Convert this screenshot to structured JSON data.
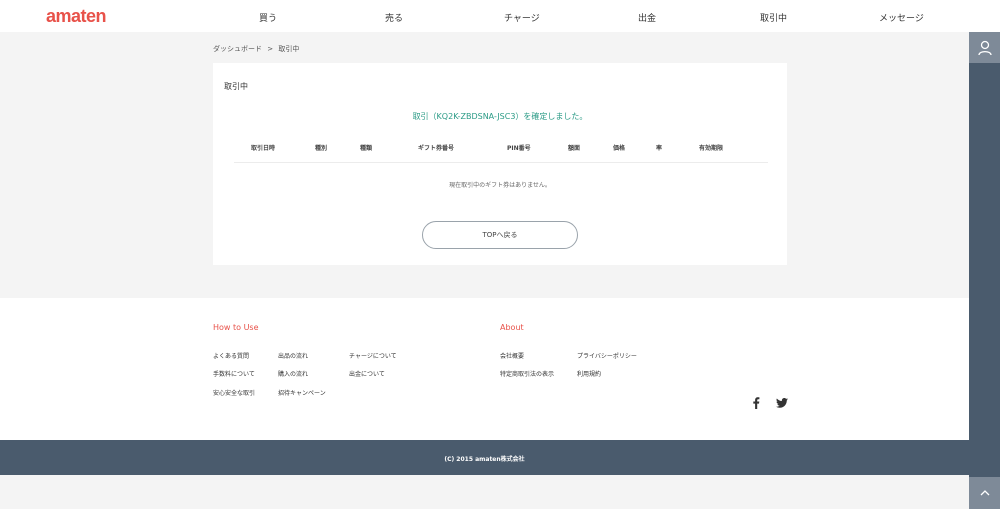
{
  "header": {
    "logo": "amaten",
    "nav": [
      {
        "label": "買う"
      },
      {
        "label": "売る"
      },
      {
        "label": "チャージ"
      },
      {
        "label": "出金"
      },
      {
        "label": "取引中"
      },
      {
        "label": "メッセージ"
      }
    ]
  },
  "breadcrumb": {
    "home": "ダッシュボード",
    "separator": ">",
    "current": "取引中"
  },
  "main": {
    "title": "取引中",
    "confirm_message": "取引（KQ2K-ZBDSNA-JSC3）を確定しました。",
    "table": {
      "columns": [
        "取引日時",
        "種別",
        "種類",
        "ギフト券番号",
        "PIN番号",
        "額面",
        "価格",
        "率",
        "有効期限"
      ],
      "empty_message": "現在取引中のギフト券はありません。"
    },
    "back_button": "TOPへ戻る"
  },
  "footer": {
    "how_to_use": {
      "heading": "How to Use",
      "links": [
        "よくある質問",
        "出品の流れ",
        "チャージについて",
        "手数料について",
        "購入の流れ",
        "出金について",
        "安心安全な取引",
        "招待キャンペーン"
      ]
    },
    "about": {
      "heading": "About",
      "links": [
        "会社概要",
        "プライバシーポリシー",
        "特定商取引法の表示",
        "利用規約"
      ]
    },
    "social": [
      "facebook-icon",
      "twitter-icon"
    ],
    "copyright": "(C) 2015 amaten株式会社"
  },
  "colors": {
    "brand": "#e8524a",
    "success": "#2b9b86",
    "rail": "#4a5b6d"
  }
}
